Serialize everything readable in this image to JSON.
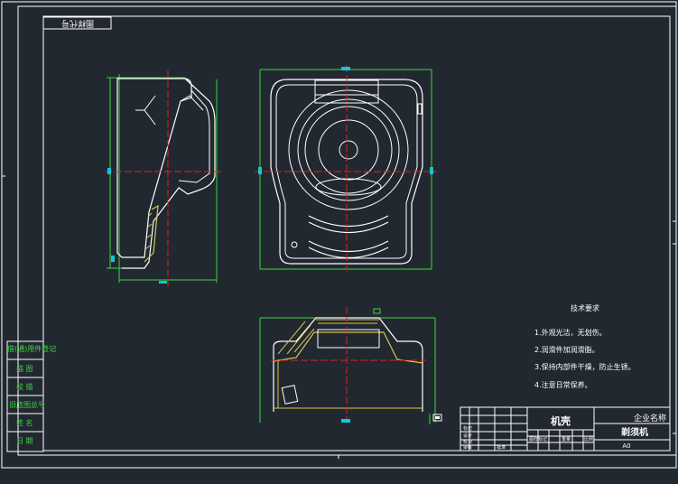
{
  "drawing": {
    "stamp_corner": "图样代号",
    "sheet_size": "A0",
    "part_name": "机壳",
    "assembly_name": "剃须机",
    "company_name": "企业名称"
  },
  "side_labels": [
    "借(通)用件登记",
    "描 图",
    "校 描",
    "旧底图总号",
    "签 名",
    "日 期"
  ],
  "tech_requirements": {
    "title": "技术要求",
    "items": [
      "1.外观光洁，无划伤。",
      "2.润滑件加润滑脂。",
      "3.保持内部件干燥，防止生锈。",
      "4.注意日常保养。"
    ]
  },
  "title_block": {
    "row_labels": [
      "标记",
      "设计",
      "校对",
      "审核",
      "批准"
    ],
    "col_labels": [
      "图样标记",
      "重量",
      "比例"
    ]
  },
  "colors": {
    "background": "#212830",
    "outline": "#ffffff",
    "dimension": "#3cd73c",
    "centerline": "#e02020",
    "marker": "#10c8d8",
    "hatch": "#d8c850"
  }
}
